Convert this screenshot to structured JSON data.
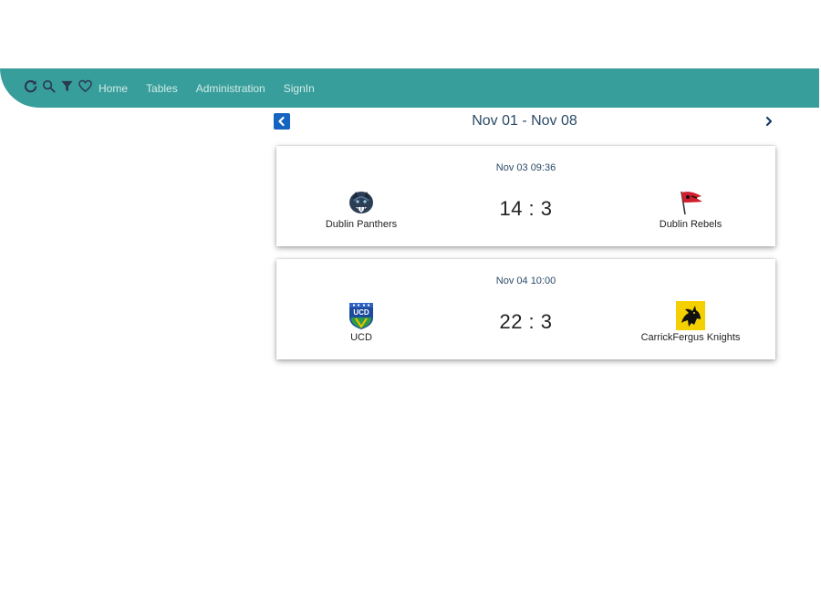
{
  "navbar": {
    "background": "#389e9b",
    "icons": [
      "refresh-icon",
      "search-icon",
      "filter-icon",
      "heart-icon"
    ],
    "links": [
      "Home",
      "Tables",
      "Administration",
      "SignIn"
    ]
  },
  "week": {
    "label": "Nov 01 - Nov 08",
    "prev_icon": "chevron-left-icon",
    "next_icon": "chevron-right-icon"
  },
  "matches": [
    {
      "datetime": "Nov 03 09:36",
      "home": {
        "name": "Dublin Panthers",
        "logo": "panther-logo"
      },
      "score": "14 : 3",
      "away": {
        "name": "Dublin Rebels",
        "logo": "rebels-flag-logo"
      }
    },
    {
      "datetime": "Nov 04 10:00",
      "home": {
        "name": "UCD",
        "logo": "ucd-crest-logo"
      },
      "score": "22 : 3",
      "away": {
        "name": "CarrickFergus Knights",
        "logo": "knight-horse-logo"
      }
    }
  ]
}
